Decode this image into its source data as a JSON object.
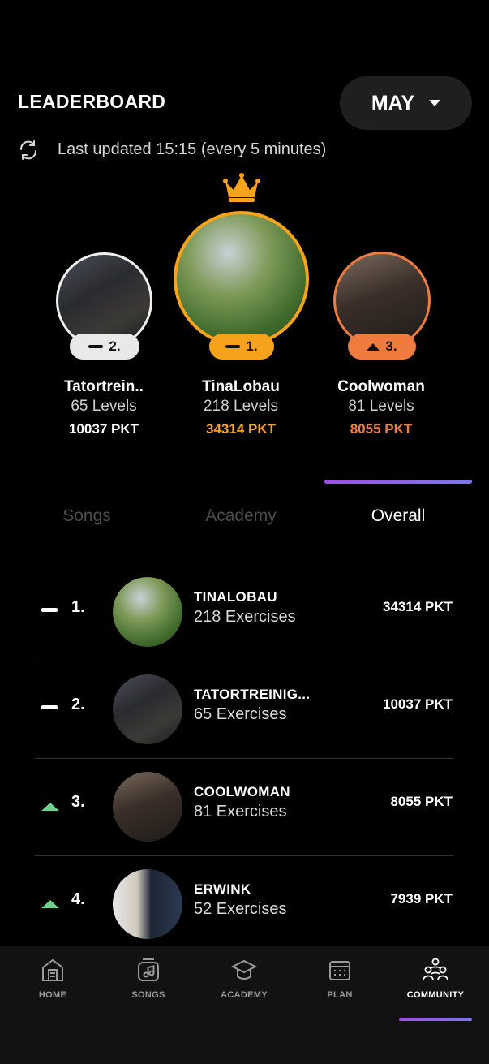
{
  "header": {
    "title": "LEADERBOARD",
    "month": "MAY",
    "last_updated": "Last updated 15:15 (every 5 minutes)"
  },
  "podium": {
    "second": {
      "rank": "2.",
      "name": "Tatortrein..",
      "levels": "65 Levels",
      "points": "10037 PKT",
      "trend": "same"
    },
    "first": {
      "rank": "1.",
      "name": "TinaLobau",
      "levels": "218 Levels",
      "points": "34314 PKT",
      "trend": "same"
    },
    "third": {
      "rank": "3.",
      "name": "Coolwoman",
      "levels": "81 Levels",
      "points": "8055 PKT",
      "trend": "up"
    }
  },
  "colors": {
    "gold": "#f7a21b",
    "silver": "#efefef",
    "bronze": "#f07b3f",
    "trend_up": "#6ed38a",
    "accent": "#a04ee6"
  },
  "tabs": [
    {
      "label": "Songs",
      "active": false
    },
    {
      "label": "Academy",
      "active": false
    },
    {
      "label": "Overall",
      "active": true
    }
  ],
  "leaderboard": [
    {
      "rank": "1.",
      "name": "TINALOBAU",
      "exercises": "218 Exercises",
      "points": "34314 PKT",
      "trend": "same"
    },
    {
      "rank": "2.",
      "name": "TATORTREINIG...",
      "exercises": "65 Exercises",
      "points": "10037 PKT",
      "trend": "same"
    },
    {
      "rank": "3.",
      "name": "COOLWOMAN",
      "exercises": "81 Exercises",
      "points": "8055 PKT",
      "trend": "up"
    },
    {
      "rank": "4.",
      "name": "ERWINK",
      "exercises": "52 Exercises",
      "points": "7939 PKT",
      "trend": "up"
    }
  ],
  "nav": [
    {
      "label": "HOME",
      "icon": "home-icon",
      "active": false
    },
    {
      "label": "SONGS",
      "icon": "music-icon",
      "active": false
    },
    {
      "label": "ACADEMY",
      "icon": "graduation-cap-icon",
      "active": false
    },
    {
      "label": "PLAN",
      "icon": "calendar-icon",
      "active": false
    },
    {
      "label": "COMMUNITY",
      "icon": "community-icon",
      "active": true
    }
  ]
}
